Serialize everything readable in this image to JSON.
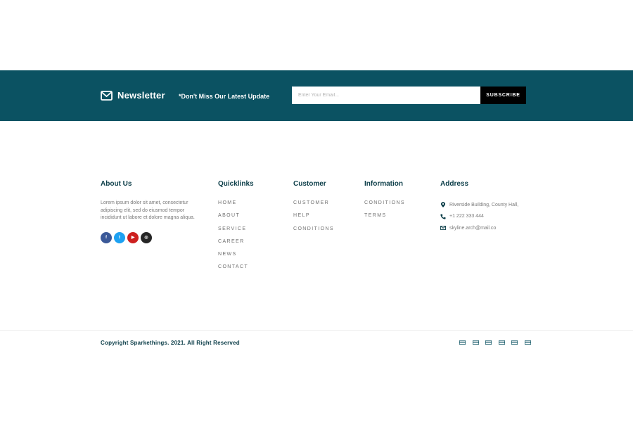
{
  "newsletter": {
    "title": "Newsletter",
    "tagline": "*Don't Miss Our Latest Update",
    "email_placeholder": "Enter Your Email...",
    "subscribe_label": "SUBSCRIBE",
    "icon": "envelope-icon"
  },
  "about": {
    "heading": "About Us",
    "text": "Lorem ipsum dolor sit amet, consectetur adipiscing elit, sed do eiusmod tempor incididunt ut labore et dolore magna aliqua.",
    "social": [
      {
        "name": "facebook-icon",
        "glyph": "f",
        "color": "#3b5998"
      },
      {
        "name": "twitter-icon",
        "glyph": "t",
        "color": "#1da1f2"
      },
      {
        "name": "youtube-icon",
        "glyph": "▶",
        "color": "#cd201f"
      },
      {
        "name": "instagram-icon",
        "glyph": "◎",
        "color": "#262626"
      }
    ]
  },
  "quicklinks": {
    "heading": "Quicklinks",
    "items": [
      "HOME",
      "ABOUT",
      "SERVICE",
      "CAREER",
      "NEWS",
      "CONTACT"
    ]
  },
  "customer": {
    "heading": "Customer",
    "items": [
      "CUSTOMER",
      "HELP",
      "CONDITIONS"
    ]
  },
  "information": {
    "heading": "Information",
    "items": [
      "CONDITIONS",
      "TERMS"
    ]
  },
  "address": {
    "heading": "Address",
    "items": [
      {
        "icon": "map-pin-icon",
        "text": "Riverside Building, County Hall,"
      },
      {
        "icon": "phone-icon",
        "text": "+1 222 333 444"
      },
      {
        "icon": "mail-icon",
        "text": "skyline.arch@mail.co"
      }
    ]
  },
  "footer": {
    "copyright": "Copyright Sparkethings. 2021. All Right Reserved",
    "payment_icons": [
      "payment-card-icon",
      "payment-card-icon",
      "payment-card-icon",
      "payment-card-icon",
      "payment-card-icon",
      "payment-card-icon"
    ]
  },
  "colors": {
    "brand": "#0b5262",
    "heading": "#0b3d48",
    "button": "#000000"
  }
}
